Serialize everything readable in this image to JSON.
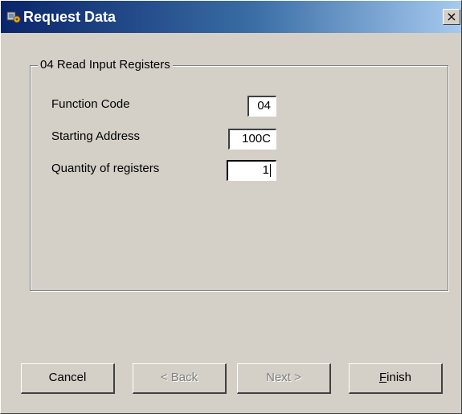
{
  "window": {
    "title": "Request Data",
    "close_glyph": "×",
    "icon": "app-icon"
  },
  "group": {
    "legend": "04  Read Input Registers",
    "function_code_label": "Function Code",
    "function_code_value": "04",
    "starting_address_label": "Starting Address",
    "starting_address_value": "100C",
    "quantity_label": "Quantity of registers",
    "quantity_value": "1"
  },
  "buttons": {
    "cancel": "Cancel",
    "back": "< Back",
    "next": "Next >",
    "finish_first": "F",
    "finish_rest": "inish"
  }
}
